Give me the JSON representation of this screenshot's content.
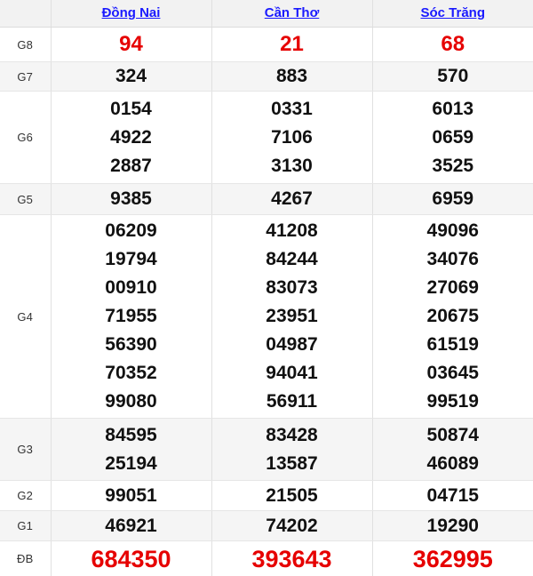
{
  "table": {
    "label_column_header": "",
    "provinces": [
      {
        "name": "Đồng Nai",
        "icon": "external-link"
      },
      {
        "name": "Cần Thơ",
        "icon": "external-link"
      },
      {
        "name": "Sóc Trăng",
        "icon": "external-link"
      }
    ],
    "colors": {
      "link": "#1a1aff",
      "highlight": "#e60000",
      "text": "#111111",
      "header_bg": "#f2f2f2",
      "stripe_bg": "#f5f5f5",
      "plain_bg": "#ffffff",
      "border": "#e0e0e0"
    },
    "rows": [
      {
        "label": "G8",
        "highlight": true,
        "cells": [
          [
            "94"
          ],
          [
            "21"
          ],
          [
            "68"
          ]
        ]
      },
      {
        "label": "G7",
        "highlight": false,
        "cells": [
          [
            "324"
          ],
          [
            "883"
          ],
          [
            "570"
          ]
        ]
      },
      {
        "label": "G6",
        "highlight": false,
        "cells": [
          [
            "0154",
            "4922",
            "2887"
          ],
          [
            "0331",
            "7106",
            "3130"
          ],
          [
            "6013",
            "0659",
            "3525"
          ]
        ]
      },
      {
        "label": "G5",
        "highlight": false,
        "cells": [
          [
            "9385"
          ],
          [
            "4267"
          ],
          [
            "6959"
          ]
        ]
      },
      {
        "label": "G4",
        "highlight": false,
        "cells": [
          [
            "06209",
            "19794",
            "00910",
            "71955",
            "56390",
            "70352",
            "99080"
          ],
          [
            "41208",
            "84244",
            "83073",
            "23951",
            "04987",
            "94041",
            "56911"
          ],
          [
            "49096",
            "34076",
            "27069",
            "20675",
            "61519",
            "03645",
            "99519"
          ]
        ]
      },
      {
        "label": "G3",
        "highlight": false,
        "cells": [
          [
            "84595",
            "25194"
          ],
          [
            "83428",
            "13587"
          ],
          [
            "50874",
            "46089"
          ]
        ]
      },
      {
        "label": "G2",
        "highlight": false,
        "cells": [
          [
            "99051"
          ],
          [
            "21505"
          ],
          [
            "04715"
          ]
        ]
      },
      {
        "label": "G1",
        "highlight": false,
        "cells": [
          [
            "46921"
          ],
          [
            "74202"
          ],
          [
            "19290"
          ]
        ]
      },
      {
        "label": "ĐB",
        "highlight": true,
        "cells": [
          [
            "684350"
          ],
          [
            "393643"
          ],
          [
            "362995"
          ]
        ]
      }
    ]
  }
}
